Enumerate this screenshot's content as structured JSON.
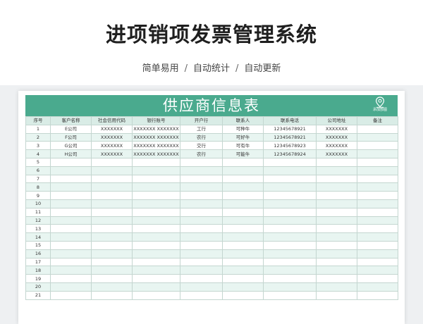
{
  "header": {
    "title": "进项销项发票管理系统",
    "tags": [
      "简单易用",
      "自动统计",
      "自动更新"
    ],
    "separator": "/"
  },
  "sheet": {
    "title": "供应商信息表",
    "logo_text": "添加部图",
    "logo_icon": "location-pin-icon",
    "accent_color": "#4aaa8e",
    "columns": [
      "序号",
      "客户名称",
      "社会信用代码",
      "银行账号",
      "开户行",
      "联系人",
      "联系电话",
      "公司地址",
      "备注"
    ],
    "rows": [
      [
        "1",
        "E公司",
        "XXXXXXX",
        "XXXXXXX XXXXXXX",
        "工行",
        "可种牛",
        "12345678921",
        "XXXXXXX",
        ""
      ],
      [
        "2",
        "F公司",
        "XXXXXXX",
        "XXXXXXX XXXXXXX",
        "农行",
        "可好牛",
        "12345678921",
        "XXXXXXX",
        ""
      ],
      [
        "3",
        "G公司",
        "XXXXXXX",
        "XXXXXXX XXXXXXX",
        "交行",
        "可有牛",
        "12345678923",
        "XXXXXXX",
        ""
      ],
      [
        "4",
        "H公司",
        "XXXXXXX",
        "XXXXXXX XXXXXXX",
        "农行",
        "可能牛",
        "12345678924",
        "XXXXXXX",
        ""
      ],
      [
        "5",
        "",
        "",
        "",
        "",
        "",
        "",
        "",
        ""
      ],
      [
        "6",
        "",
        "",
        "",
        "",
        "",
        "",
        "",
        ""
      ],
      [
        "7",
        "",
        "",
        "",
        "",
        "",
        "",
        "",
        ""
      ],
      [
        "8",
        "",
        "",
        "",
        "",
        "",
        "",
        "",
        ""
      ],
      [
        "9",
        "",
        "",
        "",
        "",
        "",
        "",
        "",
        ""
      ],
      [
        "10",
        "",
        "",
        "",
        "",
        "",
        "",
        "",
        ""
      ],
      [
        "11",
        "",
        "",
        "",
        "",
        "",
        "",
        "",
        ""
      ],
      [
        "12",
        "",
        "",
        "",
        "",
        "",
        "",
        "",
        ""
      ],
      [
        "13",
        "",
        "",
        "",
        "",
        "",
        "",
        "",
        ""
      ],
      [
        "14",
        "",
        "",
        "",
        "",
        "",
        "",
        "",
        ""
      ],
      [
        "15",
        "",
        "",
        "",
        "",
        "",
        "",
        "",
        ""
      ],
      [
        "16",
        "",
        "",
        "",
        "",
        "",
        "",
        "",
        ""
      ],
      [
        "17",
        "",
        "",
        "",
        "",
        "",
        "",
        "",
        ""
      ],
      [
        "18",
        "",
        "",
        "",
        "",
        "",
        "",
        "",
        ""
      ],
      [
        "19",
        "",
        "",
        "",
        "",
        "",
        "",
        "",
        ""
      ],
      [
        "20",
        "",
        "",
        "",
        "",
        "",
        "",
        "",
        ""
      ],
      [
        "21",
        "",
        "",
        "",
        "",
        "",
        "",
        "",
        ""
      ]
    ]
  }
}
